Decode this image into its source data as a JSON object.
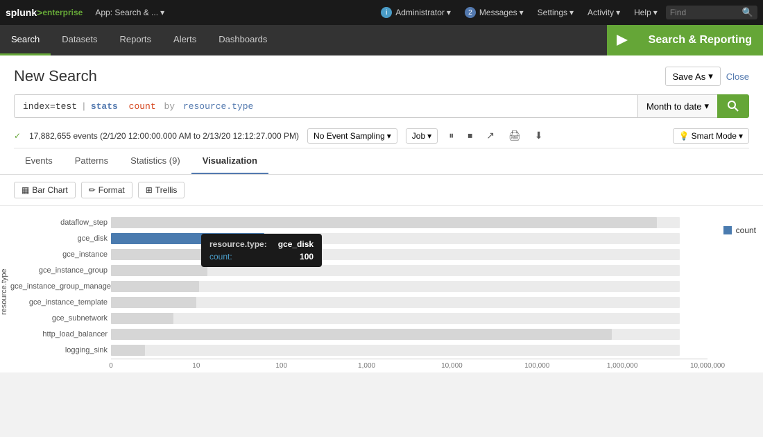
{
  "app": {
    "name": "splunk",
    "name_colored": "splunk",
    "enterprise": "enterprise",
    "logo_gt": ">",
    "app_label": "App: Search & ...",
    "find_placeholder": "Find"
  },
  "top_nav": {
    "admin_label": "Administrator",
    "messages_label": "Messages",
    "messages_count": "2",
    "settings_label": "Settings",
    "activity_label": "Activity",
    "help_label": "Help"
  },
  "sec_nav": {
    "items": [
      {
        "id": "search",
        "label": "Search",
        "active": true
      },
      {
        "id": "datasets",
        "label": "Datasets",
        "active": false
      },
      {
        "id": "reports",
        "label": "Reports",
        "active": false
      },
      {
        "id": "alerts",
        "label": "Alerts",
        "active": false
      },
      {
        "id": "dashboards",
        "label": "Dashboards",
        "active": false
      }
    ],
    "app_title": "Search & Reporting"
  },
  "search_page": {
    "title": "New Search",
    "save_as_label": "Save As",
    "close_label": "Close",
    "search_query": "index=test",
    "search_pipe": "|",
    "search_cmd": "stats",
    "search_func": "count",
    "search_by": "by",
    "search_field": "resource.type",
    "time_picker_label": "Month to date",
    "status_check": "✓",
    "status_events": "17,882,655 events (2/1/20 12:00:00.000 AM to 2/13/20 12:12:27.000 PM)",
    "no_event_sampling_label": "No Event Sampling",
    "job_label": "Job",
    "smart_mode_label": "Smart Mode"
  },
  "tabs": [
    {
      "id": "events",
      "label": "Events",
      "active": false
    },
    {
      "id": "patterns",
      "label": "Patterns",
      "active": false
    },
    {
      "id": "statistics",
      "label": "Statistics (9)",
      "active": false
    },
    {
      "id": "visualization",
      "label": "Visualization",
      "active": true
    }
  ],
  "toolbar": {
    "bar_chart_label": "Bar Chart",
    "format_label": "Format",
    "trellis_label": "Trellis"
  },
  "chart": {
    "y_axis_label": "resource.type",
    "legend_label": "count",
    "tooltip": {
      "title_key": "resource.type:",
      "title_val": "gce_disk",
      "row_key": "count:",
      "row_val": "100"
    },
    "x_ticks": [
      "0",
      "10",
      "100",
      "1,000",
      "10,000",
      "100,000",
      "1,000,000",
      "10,000,000"
    ],
    "bars": [
      {
        "label": "dataflow_step",
        "bg_width": 920,
        "fg_width": 880,
        "color": "#d6d6d6"
      },
      {
        "label": "gce_disk",
        "bg_width": 0,
        "fg_width": 195,
        "color": "#4a7baf",
        "highlighted": true
      },
      {
        "label": "gce_instance",
        "bg_width": 0,
        "fg_width": 155,
        "color": "#d6d6d6"
      },
      {
        "label": "gce_instance_group",
        "bg_width": 0,
        "fg_width": 130,
        "color": "#d6d6d6"
      },
      {
        "label": "gce_instance_group_manager",
        "bg_width": 0,
        "fg_width": 125,
        "color": "#d6d6d6"
      },
      {
        "label": "gce_instance_template",
        "bg_width": 0,
        "fg_width": 120,
        "color": "#d6d6d6"
      },
      {
        "label": "gce_subnetwork",
        "bg_width": 0,
        "fg_width": 90,
        "color": "#d6d6d6"
      },
      {
        "label": "http_load_balancer",
        "bg_width": 0,
        "fg_width": 820,
        "color": "#d6d6d6"
      },
      {
        "label": "logging_sink",
        "bg_width": 0,
        "fg_width": 55,
        "color": "#d6d6d6"
      }
    ]
  }
}
